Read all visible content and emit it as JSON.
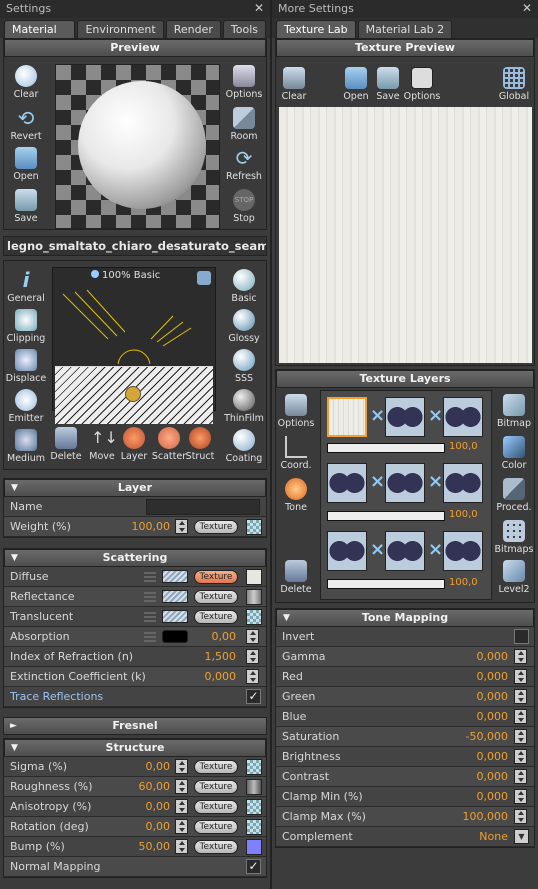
{
  "left": {
    "window_title": "Settings",
    "close": "✕",
    "tabs": [
      "Material Lab",
      "Environment",
      "Render",
      "Tools"
    ],
    "preview": {
      "title": "Preview",
      "left_tools": [
        "Clear",
        "Revert",
        "Open",
        "Save"
      ],
      "right_tools": [
        "Options",
        "Room",
        "Refresh",
        "Stop"
      ],
      "stop_badge": "STOP"
    },
    "material_name": "legno_smaltato_chiaro_desaturato_seamles",
    "layer_area": {
      "left_tools": [
        "General",
        "Clipping",
        "Displace",
        "Emitter",
        "Medium"
      ],
      "right_tools": [
        "Basic",
        "Glossy",
        "SSS",
        "ThinFilm",
        "Coating"
      ],
      "bottom_tools": [
        "Delete",
        "Move",
        "Layer",
        "Scatter",
        "Struct"
      ],
      "badge": "100% Basic"
    },
    "layer": {
      "title": "Layer",
      "name_label": "Name",
      "name_value": "",
      "weight_label": "Weight (%)",
      "weight_value": "100,00",
      "texture_btn": "Texture"
    },
    "scattering": {
      "title": "Scattering",
      "rows": [
        {
          "label": "Diffuse",
          "texture": "Texture"
        },
        {
          "label": "Reflectance",
          "texture": "Texture"
        },
        {
          "label": "Translucent",
          "texture": "Texture"
        },
        {
          "label": "Absorption",
          "value": "0,00"
        },
        {
          "label": "Index of Refraction (n)",
          "value": "1,500"
        },
        {
          "label": "Extinction Coefficient (k)",
          "value": "0,000"
        },
        {
          "label": "Trace Reflections",
          "check": "✓"
        }
      ]
    },
    "fresnel": {
      "title": "Fresnel"
    },
    "structure": {
      "title": "Structure",
      "rows": [
        {
          "label": "Sigma (%)",
          "value": "0,00",
          "texture": "Texture"
        },
        {
          "label": "Roughness (%)",
          "value": "60,00",
          "texture": "Texture"
        },
        {
          "label": "Anisotropy (%)",
          "value": "0,00",
          "texture": "Texture"
        },
        {
          "label": "Rotation (deg)",
          "value": "0,00",
          "texture": "Texture"
        },
        {
          "label": "Bump (%)",
          "value": "50,00",
          "texture": "Texture"
        },
        {
          "label": "Normal Mapping",
          "check": "✓"
        }
      ]
    }
  },
  "right": {
    "window_title": "More Settings",
    "close": "✕",
    "tabs": [
      "Texture Lab",
      "Material Lab 2"
    ],
    "preview": {
      "title": "Texture Preview",
      "tools": [
        "Clear",
        "Open",
        "Save",
        "Options",
        "Global"
      ]
    },
    "layers": {
      "title": "Texture Layers",
      "left_tools": [
        "Options",
        "Coord.",
        "Tone",
        "Delete"
      ],
      "right_tools": [
        "Bitmap",
        "Color",
        "Proced.",
        "Bitmaps",
        "Level2"
      ],
      "slider_values": [
        "100,0",
        "100,0",
        "100,0"
      ],
      "slider_levels": [
        1.0,
        1.0,
        1.0
      ]
    },
    "tone": {
      "title": "Tone Mapping",
      "rows": [
        {
          "label": "Invert"
        },
        {
          "label": "Gamma",
          "value": "0,000"
        },
        {
          "label": "Red",
          "value": "0,000"
        },
        {
          "label": "Green",
          "value": "0,000"
        },
        {
          "label": "Blue",
          "value": "0,000"
        },
        {
          "label": "Saturation",
          "value": "-50,000"
        },
        {
          "label": "Brightness",
          "value": "0,000"
        },
        {
          "label": "Contrast",
          "value": "0,000"
        },
        {
          "label": "Clamp Min (%)",
          "value": "0,000"
        },
        {
          "label": "Clamp Max (%)",
          "value": "100,000"
        },
        {
          "label": "Complement",
          "value": "None"
        }
      ]
    }
  },
  "colors": {
    "accent": "#f0a030",
    "panel": "#3c3c3c",
    "header": "#5a5a5a"
  }
}
